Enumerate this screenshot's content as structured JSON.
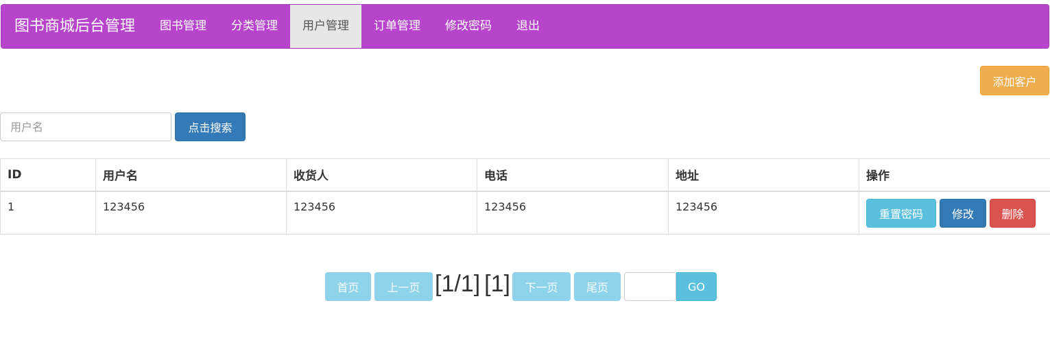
{
  "navbar": {
    "brand": "图书商城后台管理",
    "items": [
      {
        "label": "图书管理"
      },
      {
        "label": "分类管理"
      },
      {
        "label": "用户管理"
      },
      {
        "label": "订单管理"
      },
      {
        "label": "修改密码"
      },
      {
        "label": "退出"
      }
    ],
    "active": "用户管理"
  },
  "toolbar": {
    "add_customer_label": "添加客户"
  },
  "search": {
    "placeholder": "用户名",
    "value": "",
    "button_label": "点击搜索"
  },
  "table": {
    "columns": [
      "ID",
      "用户名",
      "收货人",
      "电话",
      "地址",
      "操作"
    ],
    "rows": [
      {
        "id": "1",
        "username": "123456",
        "receiver": "123456",
        "phone": "123456",
        "address": "123456"
      }
    ],
    "actions": {
      "reset_password": "重置密码",
      "edit": "修改",
      "delete": "删除"
    }
  },
  "pagination": {
    "first": "首页",
    "prev": "上一页",
    "page_of": "[1/1]",
    "current": "[1]",
    "next": "下一页",
    "last": "尾页",
    "goto_value": "",
    "go": "GO"
  },
  "colors": {
    "navbar_bg": "#b645cc",
    "active_tab_bg": "#e7e7e7",
    "warning": "#f0ad4e",
    "primary": "#337ab7",
    "info": "#5bc0de",
    "danger": "#d9534f"
  }
}
